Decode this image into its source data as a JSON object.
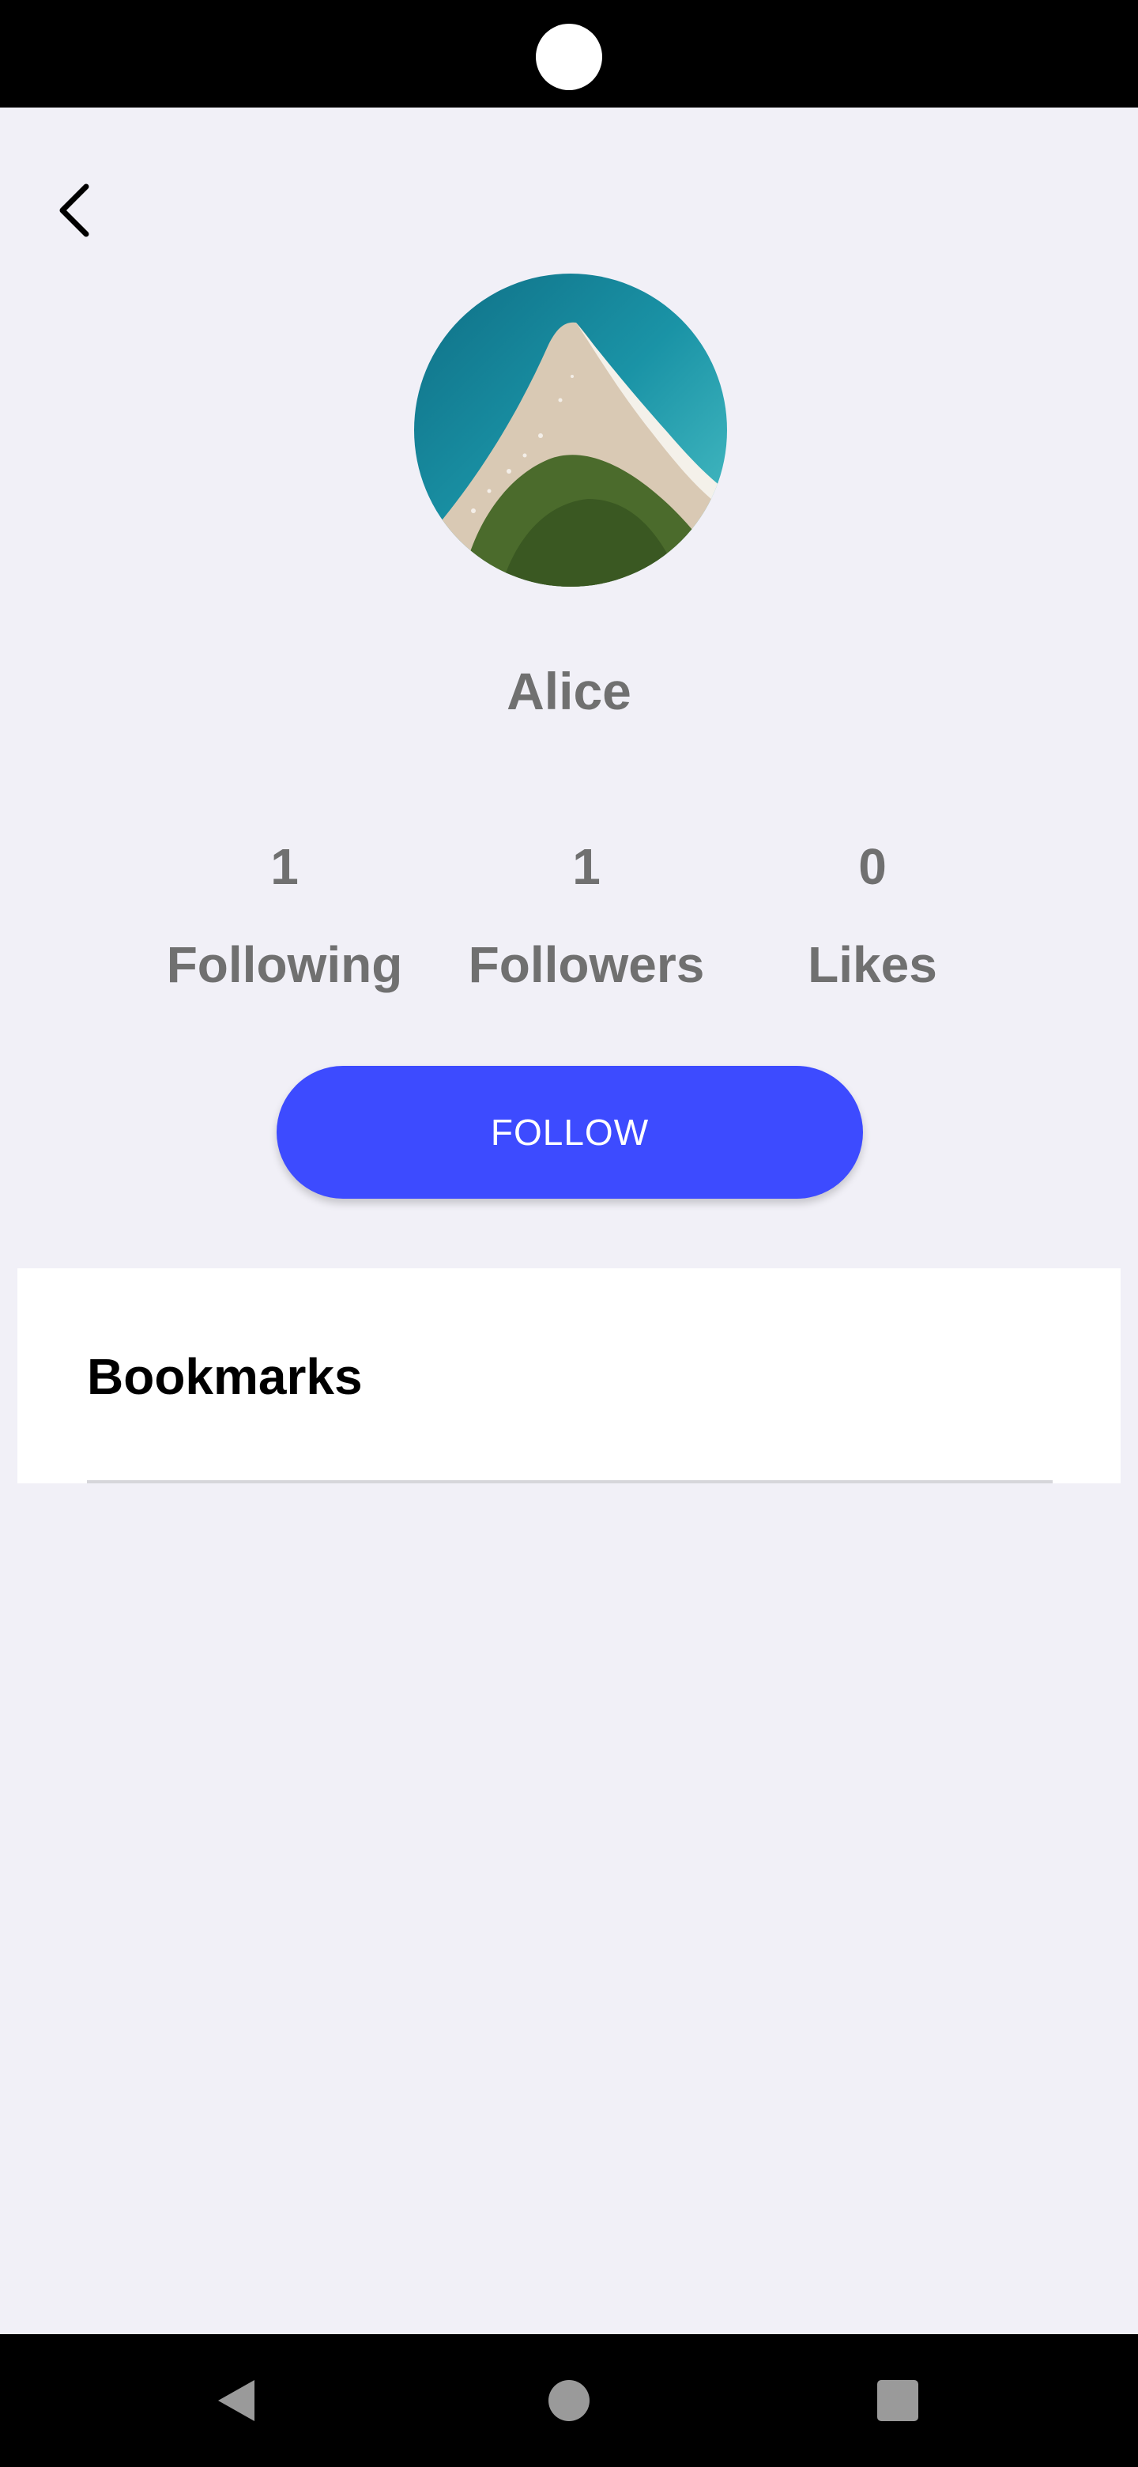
{
  "profile": {
    "name": "Alice",
    "avatar_description": "beach-peninsula-photo"
  },
  "stats": [
    {
      "value": "1",
      "label": "Following"
    },
    {
      "value": "1",
      "label": "Followers"
    },
    {
      "value": "0",
      "label": "Likes"
    }
  ],
  "actions": {
    "follow_label": "FOLLOW"
  },
  "bookmarks": {
    "title": "Bookmarks"
  },
  "icons": {
    "back": "chevron-left-icon",
    "nav_back": "triangle-back-icon",
    "nav_home": "circle-home-icon",
    "nav_recents": "square-recents-icon"
  },
  "colors": {
    "accent": "#3d4bff",
    "background": "#f1f0f7",
    "stat_text": "#707070"
  }
}
